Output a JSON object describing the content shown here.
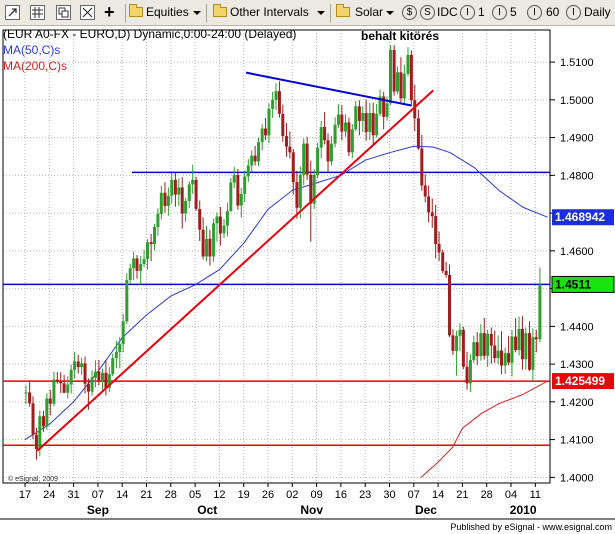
{
  "toolbar": {
    "equities_label": "Equities",
    "intervals_label": "Other Intervals",
    "solar_label": "Solar",
    "idc_label": "IDC",
    "interval_1": "1",
    "interval_5": "5",
    "interval_60": "60",
    "daily_label": "Daily",
    "circle_s": "$",
    "circle_idc": "S",
    "circle_1": "I",
    "circle_5": "I",
    "circle_60": "I",
    "circle_daily": "I",
    "plus_glyph": "+"
  },
  "colors": {
    "red": "#e8000b",
    "blue_trend": "#0000d4",
    "up_candle": "#2f9e2f",
    "down_candle": "#a11c1c",
    "ma_blue": "#2a3bd6",
    "ma_red": "#d92020",
    "grid": "#b7b7b7"
  },
  "chart_data": {
    "type": "candlestick",
    "title": "(EUR A0-FX - EURO,D) Dynamic,0:00-24:00 (Delayed)",
    "legend": [
      {
        "name": "MA(50,C)s",
        "color": "#2a3bd6"
      },
      {
        "name": "MA(200,C)s",
        "color": "#d92020"
      }
    ],
    "annotation": "behalt kitörés",
    "copyright": "© eSignal, 2009",
    "published": "Published by eSignal - www.esignal.com",
    "y_axis": {
      "min": 1.4,
      "max": 1.515,
      "ticks": [
        "1.5100",
        "1.5000",
        "1.4900",
        "1.4800",
        "1.4700",
        "1.4600",
        "1.4500",
        "1.4400",
        "1.4300",
        "1.4200",
        "1.4100",
        "1.4000"
      ]
    },
    "y_tick_values": [
      1.51,
      1.5,
      1.49,
      1.48,
      1.47,
      1.46,
      1.45,
      1.44,
      1.43,
      1.42,
      1.41,
      1.4
    ],
    "price_tags": [
      {
        "label": "1.468942",
        "value": 1.4689,
        "style": "blue"
      },
      {
        "label": "1.4511",
        "value": 1.4511,
        "style": "green"
      },
      {
        "label": "1.425499",
        "value": 1.4255,
        "style": "red"
      }
    ],
    "x_day_labels": [
      "17",
      "24",
      "31",
      "07",
      "14",
      "21",
      "28",
      "05",
      "12",
      "19",
      "26",
      "02",
      "09",
      "16",
      "23",
      "30",
      "07",
      "14",
      "21",
      "28",
      "04",
      "11"
    ],
    "x_month_labels": [
      {
        "label": "Sep",
        "at_day_index": 3
      },
      {
        "label": "Oct",
        "at_day_index": 7.5
      },
      {
        "label": "Nov",
        "at_day_index": 11.8
      },
      {
        "label": "Dec",
        "at_day_index": 16.5
      },
      {
        "label": "2010",
        "at_day_index": 20.5
      }
    ],
    "horizontal_lines": [
      {
        "value": 1.4808,
        "color": "blue",
        "from_day_index": 4.4
      },
      {
        "value": 1.4511,
        "color": "blue",
        "from_day_index": 0
      },
      {
        "value": 1.4255,
        "color": "red",
        "from_day_index": 0
      },
      {
        "value": 1.4085,
        "color": "red",
        "from_day_index": 0
      }
    ],
    "trend_lines": [
      {
        "color": "red",
        "from": {
          "day_index": 0.5,
          "value": 1.407
        },
        "to": {
          "day_index": 16.8,
          "value": 1.5025
        }
      },
      {
        "color": "blue",
        "from": {
          "day_index": 9.1,
          "value": 1.5072
        },
        "to": {
          "day_index": 15.9,
          "value": 1.4985
        }
      }
    ],
    "ma50": [
      [
        0,
        1.41
      ],
      [
        1,
        1.414
      ],
      [
        2,
        1.42
      ],
      [
        3,
        1.428
      ],
      [
        4,
        1.437
      ],
      [
        5,
        1.443
      ],
      [
        6,
        1.448
      ],
      [
        7,
        1.451
      ],
      [
        8,
        1.455
      ],
      [
        9,
        1.462
      ],
      [
        10,
        1.471
      ],
      [
        11,
        1.476
      ],
      [
        12,
        1.478
      ],
      [
        13,
        1.48
      ],
      [
        14,
        1.484
      ],
      [
        15,
        1.486
      ],
      [
        16,
        1.4877
      ],
      [
        16.8,
        1.4875
      ],
      [
        17.5,
        1.486
      ],
      [
        18.5,
        1.482
      ],
      [
        19.5,
        1.476
      ],
      [
        20.5,
        1.4715
      ],
      [
        21.5,
        1.4689
      ]
    ],
    "ma200": [
      [
        16.3,
        1.4
      ],
      [
        17,
        1.404
      ],
      [
        17.6,
        1.408
      ],
      [
        18,
        1.413
      ],
      [
        18.8,
        1.417
      ],
      [
        19.5,
        1.4195
      ],
      [
        20.5,
        1.422
      ],
      [
        21.5,
        1.4255
      ]
    ],
    "candles": [
      [
        0.04,
        1.4224,
        1.4244,
        1.4194,
        1.4225
      ],
      [
        0.19,
        1.4225,
        1.4257,
        1.4187,
        1.4196
      ],
      [
        0.33,
        1.4196,
        1.4215,
        1.4101,
        1.4113
      ],
      [
        0.47,
        1.4113,
        1.4131,
        1.4047,
        1.4075
      ],
      [
        0.61,
        1.4075,
        1.4177,
        1.4056,
        1.4162
      ],
      [
        0.76,
        1.4162,
        1.4176,
        1.4121,
        1.4135
      ],
      [
        0.9,
        1.4135,
        1.4223,
        1.4125,
        1.4209
      ],
      [
        1.04,
        1.4209,
        1.4232,
        1.4164,
        1.4195
      ],
      [
        1.19,
        1.4195,
        1.428,
        1.4188,
        1.4259
      ],
      [
        1.33,
        1.4259,
        1.4279,
        1.4248,
        1.4256
      ],
      [
        1.47,
        1.4256,
        1.4278,
        1.4224,
        1.4249
      ],
      [
        1.61,
        1.4249,
        1.4271,
        1.4223,
        1.4224
      ],
      [
        1.76,
        1.4224,
        1.4268,
        1.4209,
        1.4246
      ],
      [
        1.9,
        1.4246,
        1.4299,
        1.4222,
        1.4285
      ],
      [
        2.04,
        1.4285,
        1.4332,
        1.4262,
        1.4307
      ],
      [
        2.19,
        1.4307,
        1.4325,
        1.4275,
        1.4292
      ],
      [
        2.33,
        1.4292,
        1.4317,
        1.4272,
        1.4302
      ],
      [
        2.47,
        1.4302,
        1.432,
        1.4222,
        1.4248
      ],
      [
        2.61,
        1.4248,
        1.4262,
        1.4179,
        1.4227
      ],
      [
        2.76,
        1.4227,
        1.4283,
        1.4216,
        1.4264
      ],
      [
        2.9,
        1.4264,
        1.431,
        1.4239,
        1.428
      ],
      [
        3.04,
        1.428,
        1.4311,
        1.4244,
        1.4257
      ],
      [
        3.19,
        1.4257,
        1.4288,
        1.4231,
        1.4277
      ],
      [
        3.33,
        1.4277,
        1.4311,
        1.4217,
        1.4237
      ],
      [
        3.47,
        1.4237,
        1.4292,
        1.4226,
        1.4273
      ],
      [
        3.61,
        1.4273,
        1.4328,
        1.4268,
        1.4316
      ],
      [
        3.76,
        1.4316,
        1.4362,
        1.4289,
        1.4332
      ],
      [
        3.9,
        1.4332,
        1.4371,
        1.4289,
        1.4353
      ],
      [
        4.04,
        1.4353,
        1.4433,
        1.4331,
        1.4413
      ],
      [
        4.19,
        1.4413,
        1.4541,
        1.4406,
        1.4523
      ],
      [
        4.33,
        1.4523,
        1.4566,
        1.4514,
        1.4554
      ],
      [
        4.47,
        1.4554,
        1.4598,
        1.4522,
        1.458
      ],
      [
        4.61,
        1.458,
        1.4589,
        1.4526,
        1.4547
      ],
      [
        4.76,
        1.4547,
        1.4586,
        1.4509,
        1.4565
      ],
      [
        4.9,
        1.4565,
        1.4603,
        1.4557,
        1.4578
      ],
      [
        5.04,
        1.4578,
        1.4631,
        1.4551,
        1.4623
      ],
      [
        5.19,
        1.4623,
        1.4645,
        1.4573,
        1.4618
      ],
      [
        5.33,
        1.4618,
        1.4672,
        1.4601,
        1.4663
      ],
      [
        5.47,
        1.4663,
        1.4713,
        1.464,
        1.4698
      ],
      [
        5.61,
        1.4698,
        1.4772,
        1.4683,
        1.4754
      ],
      [
        5.76,
        1.4754,
        1.4782,
        1.4701,
        1.4719
      ],
      [
        5.9,
        1.4719,
        1.4768,
        1.4693,
        1.4746
      ],
      [
        6.04,
        1.4746,
        1.4806,
        1.4725,
        1.4788
      ],
      [
        6.19,
        1.4788,
        1.4806,
        1.4717,
        1.4749
      ],
      [
        6.33,
        1.4749,
        1.4792,
        1.4719,
        1.4768
      ],
      [
        6.47,
        1.4768,
        1.4795,
        1.4659,
        1.4699
      ],
      [
        6.61,
        1.4699,
        1.4741,
        1.4677,
        1.4732
      ],
      [
        6.76,
        1.4732,
        1.4784,
        1.4713,
        1.4776
      ],
      [
        6.9,
        1.4776,
        1.4828,
        1.4751,
        1.4788
      ],
      [
        7.04,
        1.4788,
        1.4796,
        1.4706,
        1.4711
      ],
      [
        7.19,
        1.4711,
        1.4733,
        1.4626,
        1.4656
      ],
      [
        7.33,
        1.4656,
        1.4689,
        1.4577,
        1.4585
      ],
      [
        7.47,
        1.4585,
        1.4666,
        1.4572,
        1.4632
      ],
      [
        7.61,
        1.4632,
        1.4656,
        1.4561,
        1.4585
      ],
      [
        7.76,
        1.4585,
        1.4686,
        1.4571,
        1.4673
      ],
      [
        7.9,
        1.4673,
        1.4702,
        1.4624,
        1.4691
      ],
      [
        8.04,
        1.4691,
        1.4716,
        1.4614,
        1.4646
      ],
      [
        8.19,
        1.4646,
        1.4684,
        1.4634,
        1.4667
      ],
      [
        8.33,
        1.4667,
        1.4728,
        1.4638,
        1.4705
      ],
      [
        8.47,
        1.4705,
        1.4793,
        1.4704,
        1.4781
      ],
      [
        8.61,
        1.4781,
        1.4823,
        1.4766,
        1.4801
      ],
      [
        8.76,
        1.4801,
        1.4817,
        1.4709,
        1.472
      ],
      [
        8.9,
        1.472,
        1.4767,
        1.4688,
        1.4751
      ],
      [
        9.04,
        1.4751,
        1.4813,
        1.4729,
        1.4797
      ],
      [
        9.19,
        1.4797,
        1.4843,
        1.4782,
        1.4826
      ],
      [
        9.33,
        1.4826,
        1.4866,
        1.481,
        1.4852
      ],
      [
        9.47,
        1.4852,
        1.4878,
        1.4826,
        1.4837
      ],
      [
        9.61,
        1.4837,
        1.49,
        1.4824,
        1.4888
      ],
      [
        9.76,
        1.4888,
        1.4935,
        1.4866,
        1.4924
      ],
      [
        9.9,
        1.4924,
        1.4952,
        1.4893,
        1.4906
      ],
      [
        10.04,
        1.4906,
        1.4991,
        1.4886,
        1.4976
      ],
      [
        10.19,
        1.4976,
        1.5021,
        1.4952,
        1.5
      ],
      [
        10.33,
        1.5,
        1.5044,
        1.4973,
        1.5023
      ],
      [
        10.47,
        1.5023,
        1.5049,
        1.4953,
        1.4963
      ],
      [
        10.61,
        1.4963,
        1.4987,
        1.4889,
        1.4904
      ],
      [
        10.76,
        1.4904,
        1.4939,
        1.4849,
        1.4876
      ],
      [
        10.9,
        1.4876,
        1.4916,
        1.4845,
        1.4861
      ],
      [
        11.04,
        1.4861,
        1.487,
        1.4749,
        1.4782
      ],
      [
        11.19,
        1.4782,
        1.4812,
        1.4685,
        1.4714
      ],
      [
        11.33,
        1.4714,
        1.4824,
        1.4686,
        1.4801
      ],
      [
        11.47,
        1.4801,
        1.4898,
        1.4774,
        1.4884
      ],
      [
        11.61,
        1.4884,
        1.4902,
        1.4788,
        1.4802
      ],
      [
        11.76,
        1.4802,
        1.4839,
        1.4624,
        1.4725
      ],
      [
        11.9,
        1.4725,
        1.4816,
        1.4711,
        1.4801
      ],
      [
        12.04,
        1.4801,
        1.4886,
        1.4792,
        1.4873
      ],
      [
        12.19,
        1.4873,
        1.4944,
        1.4846,
        1.4928
      ],
      [
        12.33,
        1.4928,
        1.4968,
        1.4882,
        1.4893
      ],
      [
        12.47,
        1.4893,
        1.4911,
        1.4809,
        1.4837
      ],
      [
        12.61,
        1.4837,
        1.4904,
        1.4826,
        1.4884
      ],
      [
        12.76,
        1.4884,
        1.4954,
        1.4874,
        1.4934
      ],
      [
        12.9,
        1.4934,
        1.4988,
        1.4925,
        1.4961
      ],
      [
        13.04,
        1.4961,
        1.4986,
        1.4893,
        1.4916
      ],
      [
        13.19,
        1.4916,
        1.4962,
        1.4903,
        1.494
      ],
      [
        13.33,
        1.494,
        1.4953,
        1.4851,
        1.4861
      ],
      [
        13.47,
        1.4861,
        1.4936,
        1.4845,
        1.4922
      ],
      [
        13.61,
        1.4922,
        1.4997,
        1.4917,
        1.4983
      ],
      [
        13.76,
        1.4983,
        1.4999,
        1.4906,
        1.4944
      ],
      [
        13.9,
        1.4944,
        1.4983,
        1.4915,
        1.4965
      ],
      [
        14.04,
        1.4965,
        1.5,
        1.4892,
        1.4915
      ],
      [
        14.19,
        1.4915,
        1.4992,
        1.4893,
        1.4965
      ],
      [
        14.33,
        1.4965,
        1.4993,
        1.4882,
        1.4906
      ],
      [
        14.47,
        1.4906,
        1.4989,
        1.49,
        1.4963
      ],
      [
        14.61,
        1.4963,
        1.5027,
        1.4957,
        1.5009
      ],
      [
        14.76,
        1.5009,
        1.5021,
        1.4922,
        1.4955
      ],
      [
        14.9,
        1.4955,
        1.5009,
        1.4945,
        1.4991
      ],
      [
        15.04,
        1.4991,
        1.5145,
        1.4986,
        1.5132
      ],
      [
        15.19,
        1.5132,
        1.5145,
        1.5011,
        1.5022
      ],
      [
        15.33,
        1.5022,
        1.5088,
        1.5015,
        1.5073
      ],
      [
        15.47,
        1.5073,
        1.5113,
        1.4989,
        1.5004
      ],
      [
        15.61,
        1.5004,
        1.5093,
        1.4986,
        1.5069
      ],
      [
        15.76,
        1.5069,
        1.514,
        1.5062,
        1.5119
      ],
      [
        15.9,
        1.5119,
        1.5131,
        1.4983,
        1.4999
      ],
      [
        16.04,
        1.4999,
        1.504,
        1.4917,
        1.4951
      ],
      [
        16.19,
        1.4951,
        1.4974,
        1.4868,
        1.4871
      ],
      [
        16.33,
        1.4871,
        1.4907,
        1.4759,
        1.4773
      ],
      [
        16.47,
        1.4773,
        1.4803,
        1.4728,
        1.4744
      ],
      [
        16.61,
        1.4744,
        1.4773,
        1.4676,
        1.4702
      ],
      [
        16.76,
        1.4702,
        1.4739,
        1.4661,
        1.4692
      ],
      [
        16.9,
        1.4692,
        1.4722,
        1.458,
        1.4618
      ],
      [
        17.04,
        1.4618,
        1.4651,
        1.4573,
        1.4596
      ],
      [
        17.19,
        1.4596,
        1.4603,
        1.4541,
        1.4547
      ],
      [
        17.33,
        1.4547,
        1.4571,
        1.4529,
        1.4536
      ],
      [
        17.47,
        1.4536,
        1.4564,
        1.4371,
        1.4376
      ],
      [
        17.61,
        1.4376,
        1.4392,
        1.4324,
        1.4335
      ],
      [
        17.76,
        1.4335,
        1.4388,
        1.4269,
        1.4375
      ],
      [
        17.9,
        1.4375,
        1.4408,
        1.4334,
        1.4391
      ],
      [
        18.04,
        1.4391,
        1.4399,
        1.4287,
        1.4293
      ],
      [
        18.19,
        1.4293,
        1.4332,
        1.4232,
        1.4249
      ],
      [
        18.33,
        1.4249,
        1.4326,
        1.4226,
        1.4311
      ],
      [
        18.47,
        1.4311,
        1.4375,
        1.4303,
        1.4358
      ],
      [
        18.61,
        1.4358,
        1.4385,
        1.4298,
        1.4321
      ],
      [
        18.76,
        1.4321,
        1.4406,
        1.4309,
        1.4382
      ],
      [
        18.9,
        1.4382,
        1.4422,
        1.4312,
        1.4322
      ],
      [
        19.04,
        1.4322,
        1.4391,
        1.4293,
        1.438
      ],
      [
        19.19,
        1.438,
        1.4397,
        1.4301,
        1.4349
      ],
      [
        19.33,
        1.4349,
        1.4389,
        1.4303,
        1.4316
      ],
      [
        19.47,
        1.4316,
        1.4376,
        1.4299,
        1.4336
      ],
      [
        19.61,
        1.4336,
        1.4387,
        1.4273,
        1.4296
      ],
      [
        19.76,
        1.4296,
        1.4344,
        1.4274,
        1.4329
      ],
      [
        19.9,
        1.4329,
        1.4375,
        1.4297,
        1.4304
      ],
      [
        20.04,
        1.4304,
        1.439,
        1.4267,
        1.4373
      ],
      [
        20.19,
        1.4373,
        1.4422,
        1.4331,
        1.4337
      ],
      [
        20.33,
        1.4337,
        1.4426,
        1.4323,
        1.4393
      ],
      [
        20.47,
        1.4393,
        1.4427,
        1.4285,
        1.4313
      ],
      [
        20.61,
        1.4313,
        1.4397,
        1.4285,
        1.4382
      ],
      [
        20.76,
        1.4382,
        1.4413,
        1.4281,
        1.4285
      ],
      [
        20.9,
        1.4285,
        1.4395,
        1.4256,
        1.4371
      ],
      [
        21.04,
        1.4371,
        1.4391,
        1.4331,
        1.4366
      ],
      [
        21.19,
        1.4366,
        1.4556,
        1.4358,
        1.4511
      ]
    ]
  }
}
